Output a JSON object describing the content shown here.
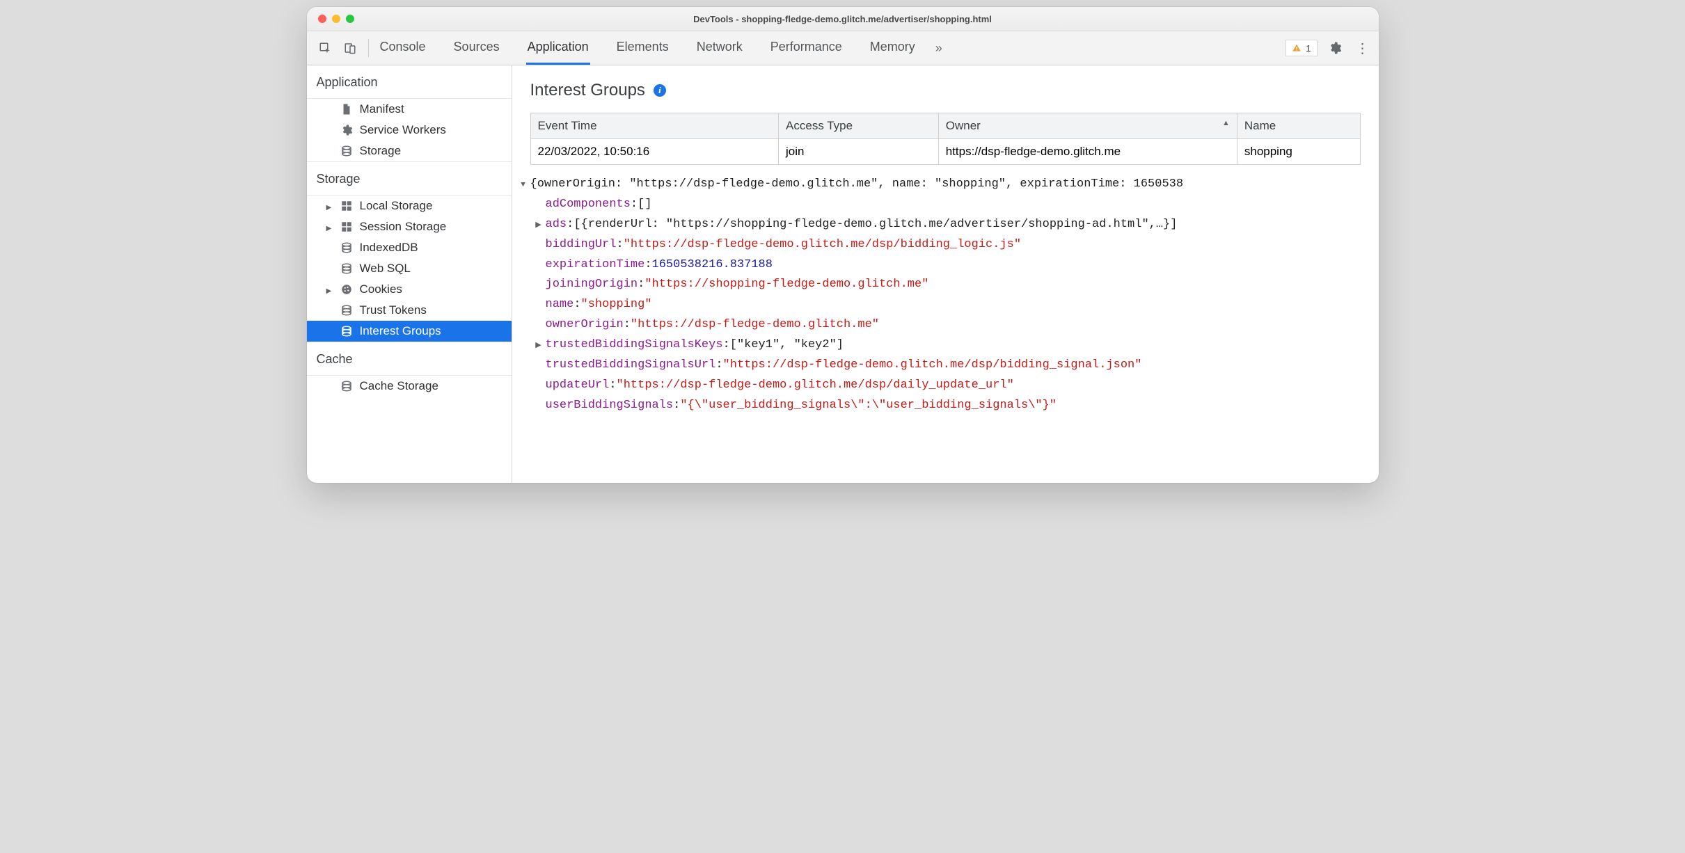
{
  "window": {
    "title": "DevTools - shopping-fledge-demo.glitch.me/advertiser/shopping.html"
  },
  "tabs": {
    "items": [
      "Console",
      "Sources",
      "Application",
      "Elements",
      "Network",
      "Performance",
      "Memory"
    ],
    "active": "Application"
  },
  "toolbar": {
    "warningCount": "1"
  },
  "sidebar": {
    "groups": [
      {
        "title": "Application",
        "items": [
          {
            "label": "Manifest",
            "icon": "file",
            "tri": false
          },
          {
            "label": "Service Workers",
            "icon": "gear",
            "tri": false
          },
          {
            "label": "Storage",
            "icon": "db",
            "tri": false
          }
        ]
      },
      {
        "title": "Storage",
        "items": [
          {
            "label": "Local Storage",
            "icon": "grid",
            "tri": true
          },
          {
            "label": "Session Storage",
            "icon": "grid",
            "tri": true
          },
          {
            "label": "IndexedDB",
            "icon": "db",
            "tri": false
          },
          {
            "label": "Web SQL",
            "icon": "db",
            "tri": false
          },
          {
            "label": "Cookies",
            "icon": "cookie",
            "tri": true
          },
          {
            "label": "Trust Tokens",
            "icon": "db",
            "tri": false
          },
          {
            "label": "Interest Groups",
            "icon": "db",
            "tri": false,
            "selected": true
          }
        ]
      },
      {
        "title": "Cache",
        "items": [
          {
            "label": "Cache Storage",
            "icon": "db",
            "tri": false
          }
        ]
      }
    ]
  },
  "main": {
    "heading": "Interest Groups",
    "table": {
      "columns": [
        "Event Time",
        "Access Type",
        "Owner",
        "Name"
      ],
      "sortedColumnIndex": 2,
      "rows": [
        [
          "22/03/2022, 10:50:16",
          "join",
          "https://dsp-fledge-demo.glitch.me",
          "shopping"
        ]
      ]
    },
    "details": {
      "line0_text": "{ownerOrigin: \"https://dsp-fledge-demo.glitch.me\", name: \"shopping\", expirationTime: 1650538",
      "adComponents_key": "adComponents",
      "adComponents_val": "[]",
      "ads_key": "ads",
      "ads_val": "[{renderUrl: \"https://shopping-fledge-demo.glitch.me/advertiser/shopping-ad.html\",…}]",
      "biddingUrl_key": "biddingUrl",
      "biddingUrl_val": "\"https://dsp-fledge-demo.glitch.me/dsp/bidding_logic.js\"",
      "expirationTime_key": "expirationTime",
      "expirationTime_val": "1650538216.837188",
      "joiningOrigin_key": "joiningOrigin",
      "joiningOrigin_val": "\"https://shopping-fledge-demo.glitch.me\"",
      "name_key": "name",
      "name_val": "\"shopping\"",
      "ownerOrigin_key": "ownerOrigin",
      "ownerOrigin_val": "\"https://dsp-fledge-demo.glitch.me\"",
      "tbsk_key": "trustedBiddingSignalsKeys",
      "tbsk_val": "[\"key1\", \"key2\"]",
      "tbsu_key": "trustedBiddingSignalsUrl",
      "tbsu_val": "\"https://dsp-fledge-demo.glitch.me/dsp/bidding_signal.json\"",
      "updateUrl_key": "updateUrl",
      "updateUrl_val": "\"https://dsp-fledge-demo.glitch.me/dsp/daily_update_url\"",
      "ubs_key": "userBiddingSignals",
      "ubs_val": "\"{\\\"user_bidding_signals\\\":\\\"user_bidding_signals\\\"}\""
    }
  }
}
